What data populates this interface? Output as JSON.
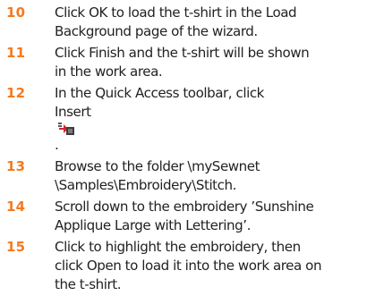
{
  "accent_color": "#f47a20",
  "text_color": "#231f20",
  "steps": [
    {
      "number": "10",
      "lines": [
        "Click OK to load the t-shirt in the Load",
        "Background page of the wizard."
      ]
    },
    {
      "number": "11",
      "lines": [
        "Click Finish and the t-shirt will be shown",
        "in the work area."
      ]
    },
    {
      "number": "12",
      "lines": [
        "In the Quick Access toolbar, click",
        "Insert"
      ],
      "icon": "insert-icon",
      "after_icon": "."
    },
    {
      "number": "13",
      "lines": [
        "Browse to the folder \\mySewnet",
        "\\Samples\\Embroidery\\Stitch."
      ]
    },
    {
      "number": "14",
      "lines": [
        "Scroll down to the embroidery ’Sunshine",
        "Applique Large with Lettering’."
      ]
    },
    {
      "number": "15",
      "lines": [
        "Click to highlight the embroidery, then",
        "click Open to load it into the work area on",
        "the t-shirt."
      ]
    }
  ]
}
